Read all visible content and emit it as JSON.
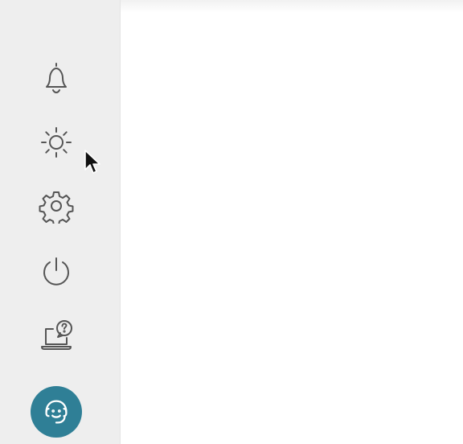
{
  "sidebar": {
    "items": [
      {
        "id": "notifications",
        "icon": "bell-icon"
      },
      {
        "id": "brightness",
        "icon": "sun-icon"
      },
      {
        "id": "settings",
        "icon": "gear-icon"
      },
      {
        "id": "power",
        "icon": "power-icon"
      },
      {
        "id": "help",
        "icon": "laptop-help-icon"
      }
    ],
    "support": {
      "icon": "headset-smiley-icon",
      "color": "#2f7f96"
    }
  },
  "colors": {
    "sidebar_bg": "#eeeeee",
    "icon_stroke": "#555555",
    "content_bg": "#ffffff"
  }
}
